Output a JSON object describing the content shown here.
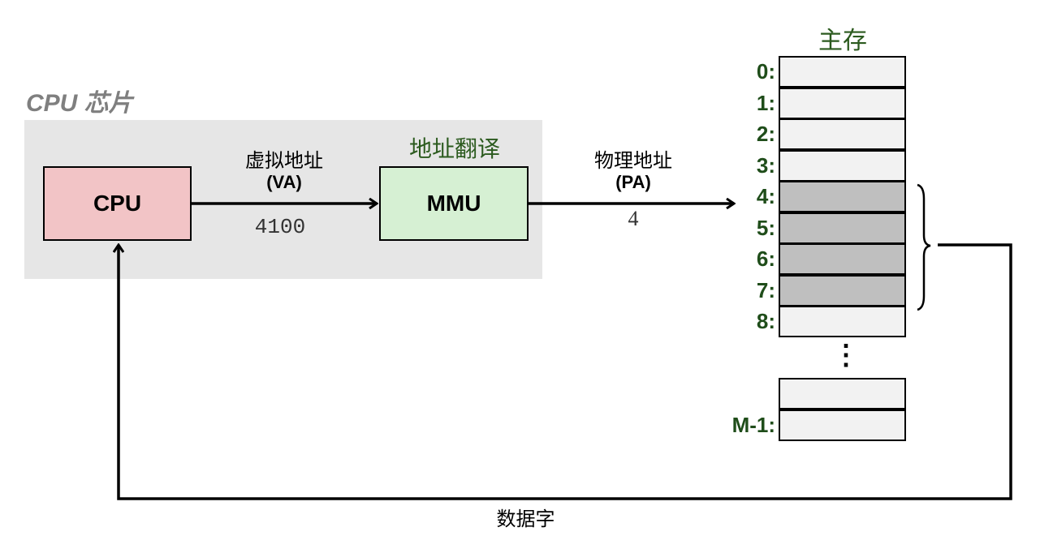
{
  "chip": {
    "title": "CPU 芯片"
  },
  "cpu": {
    "label": "CPU",
    "color": "#f2c4c6"
  },
  "mmu": {
    "label": "MMU",
    "title": "地址翻译",
    "color": "#d6f0d3"
  },
  "virtual_address": {
    "label_cn": "虚拟地址",
    "label_abbr": "(VA)",
    "value": "4100"
  },
  "physical_address": {
    "label_cn": "物理地址",
    "label_abbr": "(PA)",
    "value": "4"
  },
  "memory": {
    "title": "主存",
    "cells": [
      {
        "address": "0:",
        "highlighted": false
      },
      {
        "address": "1:",
        "highlighted": false
      },
      {
        "address": "2:",
        "highlighted": false
      },
      {
        "address": "3:",
        "highlighted": false
      },
      {
        "address": "4:",
        "highlighted": true
      },
      {
        "address": "5:",
        "highlighted": true
      },
      {
        "address": "6:",
        "highlighted": true
      },
      {
        "address": "7:",
        "highlighted": true
      },
      {
        "address": "8:",
        "highlighted": false
      }
    ],
    "ellipsis": "⋮",
    "tail_cells": [
      {
        "address": "",
        "highlighted": false
      },
      {
        "address": "M-1:",
        "highlighted": false
      }
    ],
    "highlight_color": "#bfbfbf",
    "cell_color": "#f2f2f2"
  },
  "data_word": {
    "label": "数据字"
  }
}
